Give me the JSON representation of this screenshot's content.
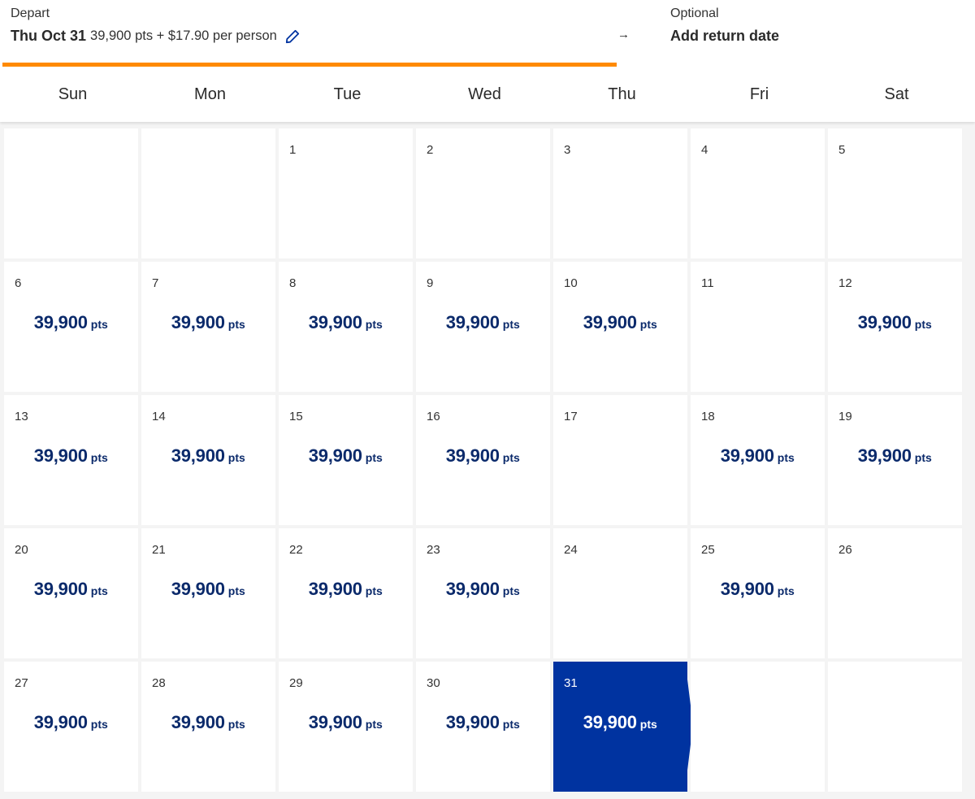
{
  "header": {
    "depart_label": "Depart",
    "depart_date": "Thu Oct 31",
    "depart_fare": "39,900 pts + $17.90 per person",
    "edit_icon": "pencil-icon",
    "arrow": "→",
    "return_label": "Optional",
    "return_action": "Add return date",
    "progress_color": "#ff8a00",
    "progress_fraction": 0.63
  },
  "weekdays": [
    "Sun",
    "Mon",
    "Tue",
    "Wed",
    "Thu",
    "Fri",
    "Sat"
  ],
  "calendar": {
    "selected_color": "#0033a0",
    "price_color": "#0b2a6b",
    "cells": [
      {
        "day": "",
        "price": null
      },
      {
        "day": "",
        "price": null
      },
      {
        "day": "1",
        "price": null
      },
      {
        "day": "2",
        "price": null
      },
      {
        "day": "3",
        "price": null
      },
      {
        "day": "4",
        "price": null
      },
      {
        "day": "5",
        "price": null
      },
      {
        "day": "6",
        "price": "39,900"
      },
      {
        "day": "7",
        "price": "39,900"
      },
      {
        "day": "8",
        "price": "39,900"
      },
      {
        "day": "9",
        "price": "39,900"
      },
      {
        "day": "10",
        "price": "39,900"
      },
      {
        "day": "11",
        "price": null
      },
      {
        "day": "12",
        "price": "39,900"
      },
      {
        "day": "13",
        "price": "39,900"
      },
      {
        "day": "14",
        "price": "39,900"
      },
      {
        "day": "15",
        "price": "39,900"
      },
      {
        "day": "16",
        "price": "39,900"
      },
      {
        "day": "17",
        "price": null
      },
      {
        "day": "18",
        "price": "39,900"
      },
      {
        "day": "19",
        "price": "39,900"
      },
      {
        "day": "20",
        "price": "39,900"
      },
      {
        "day": "21",
        "price": "39,900"
      },
      {
        "day": "22",
        "price": "39,900"
      },
      {
        "day": "23",
        "price": "39,900"
      },
      {
        "day": "24",
        "price": null
      },
      {
        "day": "25",
        "price": "39,900"
      },
      {
        "day": "26",
        "price": null
      },
      {
        "day": "27",
        "price": "39,900"
      },
      {
        "day": "28",
        "price": "39,900"
      },
      {
        "day": "29",
        "price": "39,900"
      },
      {
        "day": "30",
        "price": "39,900"
      },
      {
        "day": "31",
        "price": "39,900",
        "selected": true
      },
      {
        "day": "",
        "price": null
      },
      {
        "day": "",
        "price": null
      }
    ],
    "price_unit": "pts"
  }
}
